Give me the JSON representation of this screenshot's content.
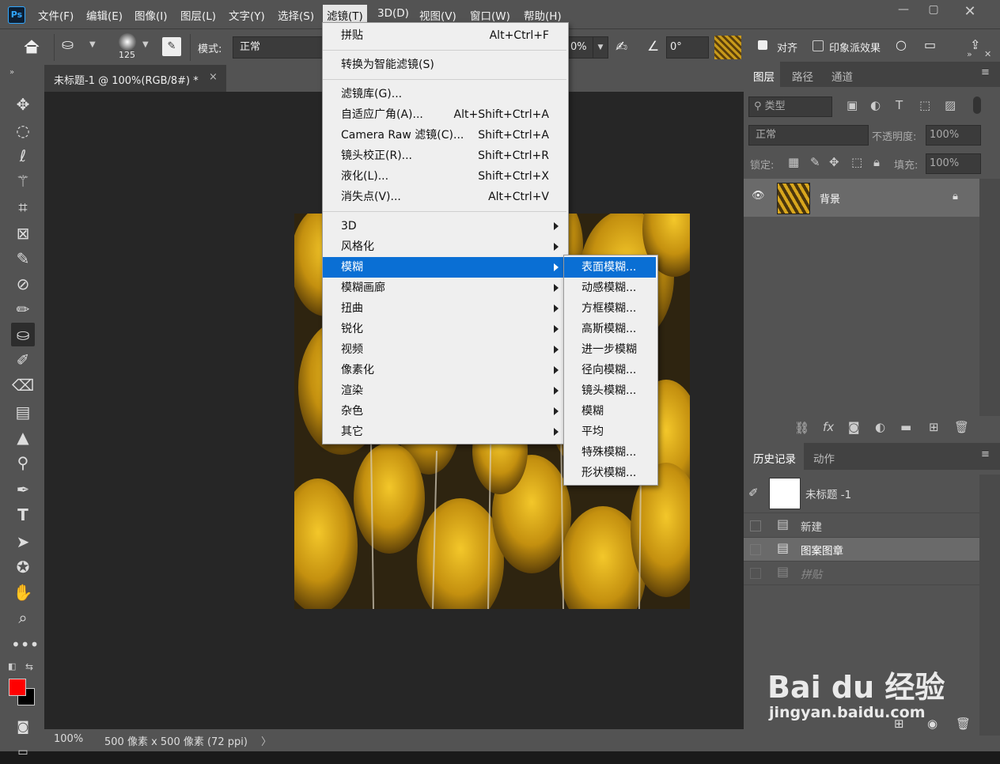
{
  "menubar": {
    "logo": "Ps",
    "items": [
      "文件(F)",
      "编辑(E)",
      "图像(I)",
      "图层(L)",
      "文字(Y)",
      "选择(S)",
      "滤镜(T)",
      "3D(D)",
      "视图(V)",
      "窗口(W)",
      "帮助(H)"
    ],
    "active": "滤镜(T)",
    "window_buttons": [
      "minimize-icon",
      "restore-icon",
      "close-icon"
    ]
  },
  "options": {
    "brush_size": "125",
    "mode_label": "模式:",
    "mode_value": "正常",
    "opacity_partial": "0%",
    "angle_value": "0°",
    "align_label": "对齐",
    "impression_label": "印象派效果"
  },
  "document": {
    "tab_title": "未标题-1 @ 100%(RGB/8#) *",
    "tab_close": "×"
  },
  "status": {
    "zoom": "100%",
    "doc_info": "500 像素 x 500 像素 (72 ppi)",
    "arrow": "〉"
  },
  "filter_menu": {
    "items": [
      {
        "label": "拼贴",
        "shortcut": "Alt+Ctrl+F"
      },
      {
        "sep": true
      },
      {
        "label": "转换为智能滤镜(S)",
        "shortcut": ""
      },
      {
        "sep": true
      },
      {
        "label": "滤镜库(G)...",
        "shortcut": ""
      },
      {
        "label": "自适应广角(A)...",
        "shortcut": "Alt+Shift+Ctrl+A"
      },
      {
        "label": "Camera Raw 滤镜(C)...",
        "shortcut": "Shift+Ctrl+A"
      },
      {
        "label": "镜头校正(R)...",
        "shortcut": "Shift+Ctrl+R"
      },
      {
        "label": "液化(L)...",
        "shortcut": "Shift+Ctrl+X"
      },
      {
        "label": "消失点(V)...",
        "shortcut": "Alt+Ctrl+V"
      },
      {
        "sep": true
      },
      {
        "label": "3D",
        "submenu": true
      },
      {
        "label": "风格化",
        "submenu": true
      },
      {
        "label": "模糊",
        "submenu": true,
        "highlighted": true
      },
      {
        "label": "模糊画廊",
        "submenu": true
      },
      {
        "label": "扭曲",
        "submenu": true
      },
      {
        "label": "锐化",
        "submenu": true
      },
      {
        "label": "视频",
        "submenu": true
      },
      {
        "label": "像素化",
        "submenu": true
      },
      {
        "label": "渲染",
        "submenu": true
      },
      {
        "label": "杂色",
        "submenu": true
      },
      {
        "label": "其它",
        "submenu": true
      }
    ]
  },
  "blur_submenu": {
    "items": [
      "表面模糊...",
      "动感模糊...",
      "方框模糊...",
      "高斯模糊...",
      "进一步模糊",
      "径向模糊...",
      "镜头模糊...",
      "模糊",
      "平均",
      "特殊模糊...",
      "形状模糊..."
    ],
    "highlighted": "表面模糊..."
  },
  "layers_panel": {
    "tabs": [
      "图层",
      "路径",
      "通道"
    ],
    "active_tab": "图层",
    "filter_placeholder": "类型",
    "blend_mode": "正常",
    "opacity_label": "不透明度:",
    "opacity_value": "100%",
    "lock_label": "锁定:",
    "fill_label": "填充:",
    "fill_value": "100%",
    "layers": [
      {
        "name": "背景",
        "visible": true,
        "locked": true
      }
    ],
    "footer_fx": "fx"
  },
  "history_panel": {
    "tabs": [
      "历史记录",
      "动作"
    ],
    "active_tab": "历史记录",
    "snapshot": "未标题 -1",
    "steps": [
      {
        "label": "新建",
        "state": "normal"
      },
      {
        "label": "图案图章",
        "state": "current"
      },
      {
        "label": "拼贴",
        "state": "undone"
      }
    ]
  },
  "watermark": {
    "brand": "Bai du 经验",
    "url": "jingyan.baidu.com"
  },
  "colors": {
    "foreground": "#ff0000",
    "background": "#000000",
    "highlight": "#0a6fd4",
    "panel": "#535353"
  }
}
